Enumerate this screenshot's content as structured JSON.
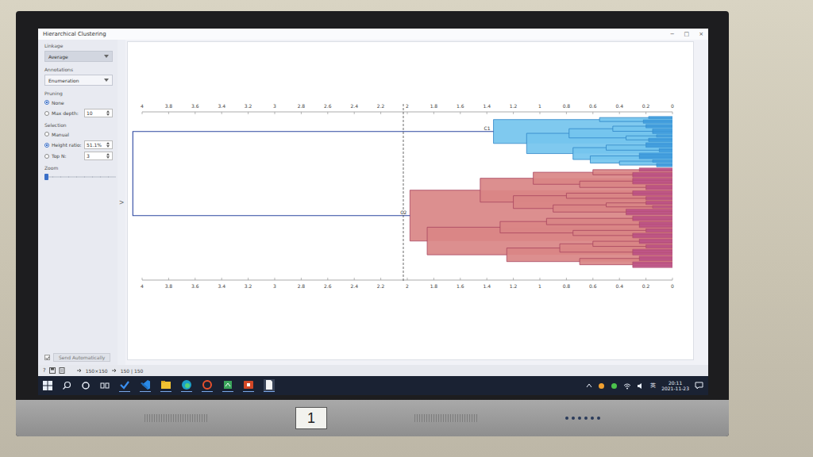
{
  "window": {
    "title": "Hierarchical Clustering",
    "controls": [
      "−",
      "□",
      "×"
    ]
  },
  "panel": {
    "linkage": {
      "label": "Linkage",
      "value": "Average"
    },
    "annotations": {
      "label": "Annotations",
      "value": "Enumeration"
    },
    "pruning": {
      "label": "Pruning",
      "options": [
        {
          "label": "None",
          "selected": true,
          "value": ""
        },
        {
          "label": "Max depth:",
          "selected": false,
          "value": "10"
        }
      ]
    },
    "selection": {
      "label": "Selection",
      "options": [
        {
          "label": "Manual",
          "selected": false,
          "value": ""
        },
        {
          "label": "Height ratio:",
          "selected": true,
          "value": "51.1%"
        },
        {
          "label": "Top N:",
          "selected": false,
          "value": "3"
        }
      ]
    },
    "zoom": {
      "label": "Zoom",
      "level": 0.0
    },
    "send": {
      "label": "Send Automatically",
      "checked": true
    },
    "collapse_glyph": ">"
  },
  "dendrogram": {
    "axis_ticks": [
      "4",
      "3.8",
      "3.6",
      "3.4",
      "3.2",
      "3",
      "2.8",
      "2.6",
      "2.4",
      "2.2",
      "2",
      "1.8",
      "1.6",
      "1.4",
      "1.2",
      "1",
      "0.8",
      "0.6",
      "0.4",
      "0.2",
      "0"
    ],
    "root_height": 4.07,
    "cut_height": 2.03,
    "clusters": [
      {
        "label": "C1",
        "color": "#74c4ee",
        "leaf_color": "#4aa6e6",
        "edge": "#2f86c8",
        "tree": {
          "h": 1.35,
          "children": [
            {
              "h": 0.55,
              "children": [
                {
                  "h": 0.18,
                  "n": 3
                },
                {
                  "h": 0.22,
                  "n": 4
                }
              ]
            },
            {
              "h": 1.1,
              "children": [
                {
                  "h": 0.78,
                  "children": [
                    {
                      "h": 0.45,
                      "children": [
                        {
                          "h": 0.2,
                          "n": 4
                        },
                        {
                          "h": 0.15,
                          "n": 5
                        }
                      ]
                    },
                    {
                      "h": 0.35,
                      "children": [
                        {
                          "h": 0.12,
                          "n": 3
                        },
                        {
                          "h": 0.18,
                          "n": 4
                        }
                      ]
                    }
                  ]
                },
                {
                  "h": 0.75,
                  "children": [
                    {
                      "h": 0.5,
                      "children": [
                        {
                          "h": 0.2,
                          "n": 5
                        },
                        {
                          "h": 0.1,
                          "n": 4
                        }
                      ]
                    },
                    {
                      "h": 0.62,
                      "children": [
                        {
                          "h": 0.25,
                          "n": 6
                        },
                        {
                          "h": 0.4,
                          "children": [
                            {
                              "h": 0.15,
                              "n": 3
                            },
                            {
                              "h": 0.12,
                              "n": 4
                            }
                          ]
                        }
                      ]
                    }
                  ]
                }
              ]
            }
          ]
        }
      },
      {
        "label": "C2",
        "color": "#d98585",
        "leaf_color": "#c65a98",
        "edge": "#a8445e",
        "tree": {
          "h": 1.98,
          "children": [
            {
              "h": 1.45,
              "children": [
                {
                  "h": 1.05,
                  "children": [
                    {
                      "h": 0.6,
                      "children": [
                        {
                          "h": 0.25,
                          "n": 4
                        },
                        {
                          "h": 0.3,
                          "n": 5
                        }
                      ]
                    },
                    {
                      "h": 0.7,
                      "children": [
                        {
                          "h": 0.3,
                          "n": 6
                        },
                        {
                          "h": 0.2,
                          "n": 5
                        }
                      ]
                    }
                  ]
                },
                {
                  "h": 1.2,
                  "children": [
                    {
                      "h": 0.8,
                      "children": [
                        {
                          "h": 0.3,
                          "n": 5
                        },
                        {
                          "h": 0.2,
                          "n": 4
                        }
                      ]
                    },
                    {
                      "h": 0.9,
                      "children": [
                        {
                          "h": 0.5,
                          "children": [
                            {
                              "h": 0.2,
                              "n": 4
                            },
                            {
                              "h": 0.15,
                              "n": 3
                            }
                          ]
                        },
                        {
                          "h": 0.35,
                          "n": 6
                        }
                      ]
                    }
                  ]
                }
              ]
            },
            {
              "h": 1.85,
              "children": [
                {
                  "h": 1.3,
                  "children": [
                    {
                      "h": 0.95,
                      "children": [
                        {
                          "h": 0.3,
                          "n": 5
                        },
                        {
                          "h": 0.25,
                          "n": 6
                        }
                      ]
                    },
                    {
                      "h": 0.75,
                      "children": [
                        {
                          "h": 0.2,
                          "n": 4
                        },
                        {
                          "h": 0.3,
                          "n": 5
                        }
                      ]
                    }
                  ]
                },
                {
                  "h": 1.25,
                  "children": [
                    {
                      "h": 0.85,
                      "children": [
                        {
                          "h": 0.6,
                          "children": [
                            {
                              "h": 0.25,
                              "n": 5
                            },
                            {
                              "h": 0.2,
                              "n": 4
                            }
                          ]
                        },
                        {
                          "h": 0.3,
                          "n": 6
                        }
                      ]
                    },
                    {
                      "h": 0.7,
                      "children": [
                        {
                          "h": 0.25,
                          "n": 5
                        },
                        {
                          "h": 0.3,
                          "n": 6
                        }
                      ]
                    }
                  ]
                }
              ]
            }
          ]
        }
      }
    ]
  },
  "status_bar": {
    "help": "?",
    "input": "150×150",
    "output": "150 | 150"
  },
  "taskbar": {
    "ime": "英",
    "time": "20:11",
    "date": "2021-11-23"
  },
  "monitor": {
    "label": "1"
  }
}
